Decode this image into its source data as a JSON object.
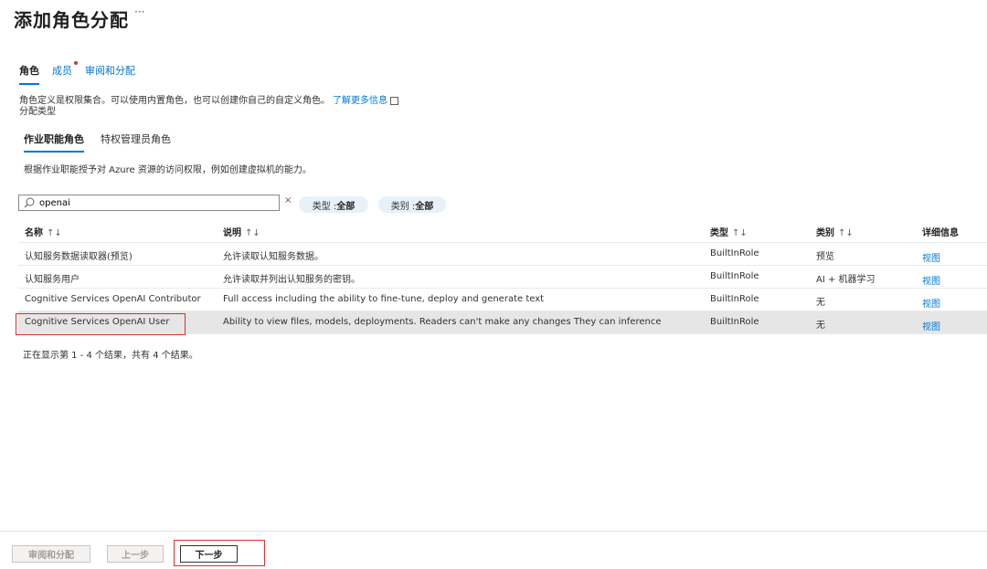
{
  "header": {
    "title": "添加角色分配",
    "more": "···"
  },
  "tabs": [
    {
      "label": "角色",
      "active": true
    },
    {
      "label": "成员",
      "dot_color": "#d13438"
    },
    {
      "label": "审阅和分配"
    }
  ],
  "description": {
    "text": "角色定义是权限集合。可以使用内置角色，也可以创建你自己的自定义角色。",
    "link": "了解更多信息"
  },
  "assignment_type_label": "分配类型",
  "subtabs": [
    {
      "label": "作业职能角色",
      "active": true
    },
    {
      "label": "特权管理员角色"
    }
  ],
  "subtab_description": "根据作业职能授予对 Azure 资源的访问权限，例如创建虚拟机的能力。",
  "search": {
    "value": "openai",
    "clear": "×"
  },
  "filters": {
    "type": {
      "label": "类型 : ",
      "value": "全部"
    },
    "category": {
      "label": "类别 : ",
      "value": "全部"
    }
  },
  "table": {
    "headers": {
      "name": "名称",
      "name_sort": "↑↓",
      "desc": "说明",
      "desc_sort": "↑↓",
      "type": "类型",
      "type_sort": "↑↓",
      "category": "类别",
      "category_sort": "↑↓",
      "details": "详细信息"
    },
    "rows": [
      {
        "name": "认知服务数据读取器(预览)",
        "description": "允许读取认知服务数据。",
        "type": "BuiltInRole",
        "category": "预览",
        "details": "视图"
      },
      {
        "name": "认知服务用户",
        "description": "允许读取并列出认知服务的密钥。",
        "type": "BuiltInRole",
        "category": "AI + 机器学习",
        "details": "视图"
      },
      {
        "name": "Cognitive Services OpenAI Contributor",
        "description": "Full access including the ability to fine-tune, deploy and generate text",
        "type": "BuiltInRole",
        "category": "无",
        "details": "视图"
      },
      {
        "name": "Cognitive Services OpenAI User",
        "description": "Ability to view files, models, deployments. Readers can't make any changes They can inference",
        "type": "BuiltInRole",
        "category": "无",
        "details": "视图",
        "selected": true
      }
    ]
  },
  "result_info": "正在显示第 1 - 4 个结果，共有 4 个结果。",
  "footer": {
    "review_assign": "审阅和分配",
    "previous": "上一步",
    "next": "下一步"
  },
  "colors": {
    "accent": "#0078d4",
    "highlight": "#d9302f"
  }
}
